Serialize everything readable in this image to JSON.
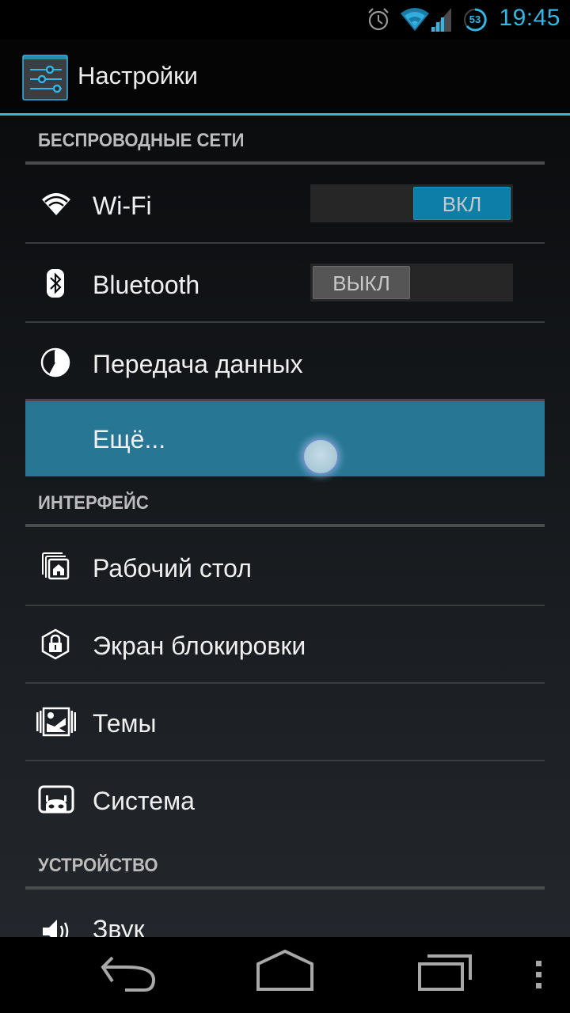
{
  "status_bar": {
    "time": "19:45",
    "battery_level": "53",
    "icons": [
      "alarm-icon",
      "wifi-signal-icon",
      "cell-signal-icon",
      "battery-icon"
    ],
    "accent_color": "#33b5e5"
  },
  "action_bar": {
    "title": "Настройки",
    "icon": "settings-sliders-icon"
  },
  "sections": [
    {
      "header": "БЕСПРОВОДНЫЕ СЕТИ",
      "items": [
        {
          "label": "Wi-Fi",
          "icon": "wifi-icon",
          "toggle": {
            "state": "on",
            "label": "ВКЛ"
          }
        },
        {
          "label": "Bluetooth",
          "icon": "bluetooth-icon",
          "toggle": {
            "state": "off",
            "label": "ВЫКЛ"
          }
        },
        {
          "label": "Передача данных",
          "icon": "data-usage-icon"
        },
        {
          "label": "Ещё...",
          "icon": "",
          "pressed": true
        }
      ]
    },
    {
      "header": "ИНТЕРФЕЙС",
      "items": [
        {
          "label": "Рабочий стол",
          "icon": "launcher-home-icon"
        },
        {
          "label": "Экран блокировки",
          "icon": "lock-screen-icon"
        },
        {
          "label": "Темы",
          "icon": "themes-icon"
        },
        {
          "label": "Система",
          "icon": "system-android-icon"
        }
      ]
    },
    {
      "header": "УСТРОЙСТВО",
      "items": [
        {
          "label": "Звук",
          "icon": "sound-icon"
        }
      ]
    }
  ],
  "colors": {
    "pressed_item": "#277694",
    "toggle_on": "#0d7ea8",
    "toggle_off": "#555555"
  },
  "nav_bar": {
    "buttons": [
      "back",
      "home",
      "recent-apps",
      "menu-overflow"
    ]
  }
}
